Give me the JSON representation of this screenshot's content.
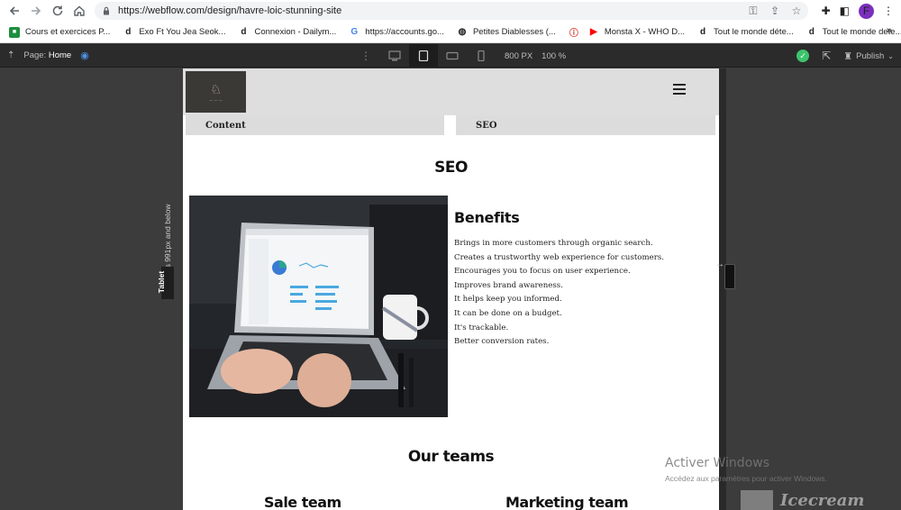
{
  "browser": {
    "url": "https://webflow.com/design/havre-loic-stunning-site",
    "profile_initial": "F",
    "bookmarks": [
      {
        "label": "Cours et exercices P...",
        "icon": "classroom-icon"
      },
      {
        "label": "Exo Ft You Jea Seok...",
        "icon": "dailymotion-icon"
      },
      {
        "label": "Connexion - Dailym...",
        "icon": "dailymotion-icon"
      },
      {
        "label": "https://accounts.go...",
        "icon": "google-icon"
      },
      {
        "label": "Petites Diablesses (...",
        "icon": "globe-icon"
      },
      {
        "label": "",
        "icon": "warning-icon"
      },
      {
        "label": "Monsta X - WHO D...",
        "icon": "youtube-icon"
      },
      {
        "label": "Tout le monde déte...",
        "icon": "dailymotion-icon"
      },
      {
        "label": "Tout le monde dete...",
        "icon": "dailymotion-icon"
      }
    ],
    "more_label": "»"
  },
  "webflow_bar": {
    "page_label": "Page:",
    "page_name": "Home",
    "width_label": "800 PX",
    "zoom_label": "100 %",
    "publish_label": "Publish"
  },
  "canvas": {
    "breakpoint_note": "Affects 991px and below",
    "breakpoint_tag": "Tablet"
  },
  "site": {
    "tabs": [
      "Content",
      "SEO"
    ],
    "seo_heading": "SEO",
    "benefits_title": "Benefits",
    "benefits": [
      "Brings in more customers through organic search.",
      "Creates a trustworthy web experience for customers.",
      "Encourages you to focus on user experience.",
      "Improves brand awareness.",
      "It helps keep you informed.",
      "It can be done on a budget.",
      "It's trackable.",
      "Better conversion rates."
    ],
    "teams_heading": "Our teams",
    "teams": [
      "Sale team",
      "Marketing team"
    ]
  },
  "watermark": {
    "title": "Activer Windows",
    "subtitle": "Accédez aux paramètres pour activer Windows.",
    "icecream": "Icecream"
  },
  "colors": {
    "publish_check": "#3ec46d",
    "profile": "#7b2fbf",
    "toolbar_bg": "#2b2b2b",
    "canvas_bg": "#3c3c3c"
  }
}
